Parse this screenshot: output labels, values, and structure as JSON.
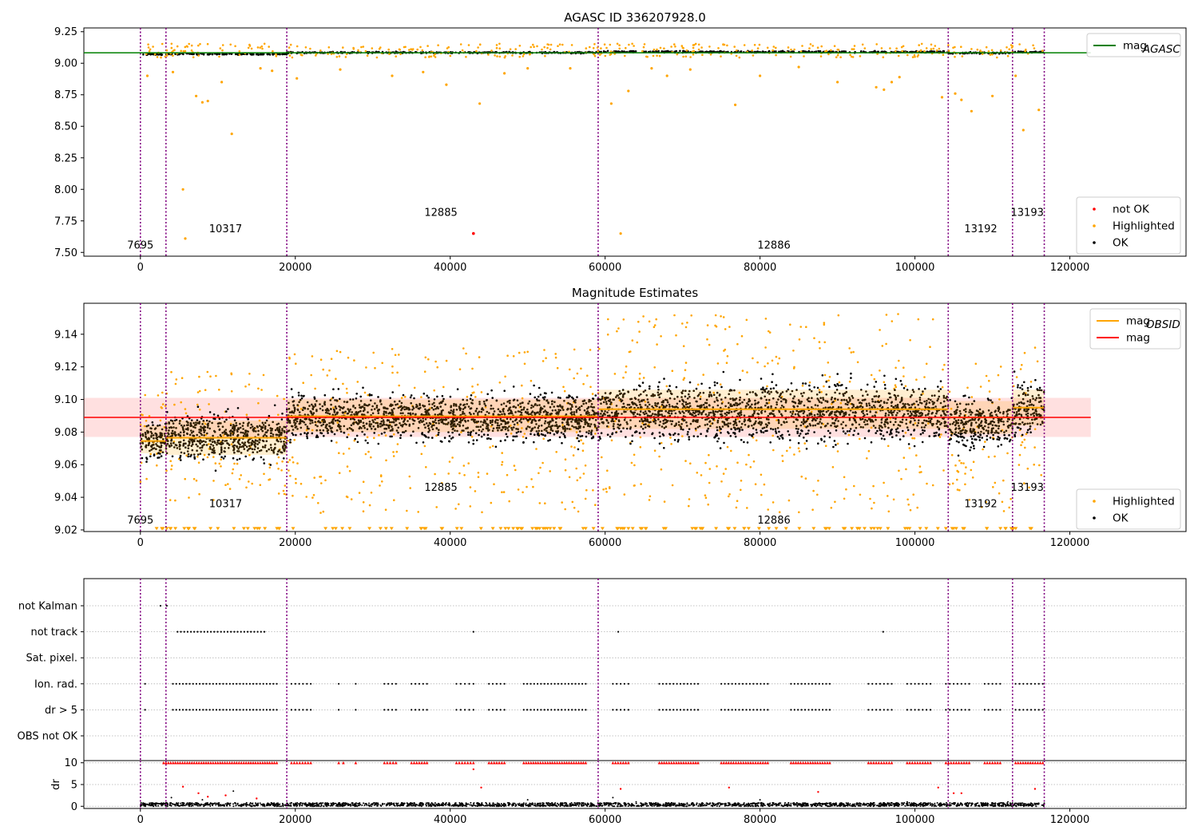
{
  "chart_data": [
    {
      "type": "scatter",
      "title": "AGASC ID 336207928.0",
      "xlim": [
        -7300,
        135000
      ],
      "ylim": [
        7.47,
        9.28
      ],
      "xticks": [
        0,
        20000,
        40000,
        60000,
        80000,
        100000,
        120000
      ],
      "yticks": [
        7.5,
        7.75,
        8.0,
        8.25,
        8.5,
        8.75,
        9.0,
        9.25
      ],
      "xtick_labels": [
        "0",
        "20000",
        "40000",
        "60000",
        "80000",
        "100000",
        "120000"
      ],
      "ytick_labels": [
        "7.50",
        "7.75",
        "8.00",
        "8.25",
        "8.50",
        "8.75",
        "9.00",
        "9.25"
      ],
      "lines": [
        {
          "name": "mag",
          "subscript": "AGASC",
          "y": 9.083,
          "x": [
            -7300,
            122700
          ],
          "color": "#008000"
        }
      ],
      "legends": [
        {
          "loc": "upper right",
          "items": [
            {
              "label": "mag",
              "sub": "AGASC",
              "kind": "line",
              "color": "#008000"
            }
          ]
        },
        {
          "loc": "lower right",
          "items": [
            {
              "label": "not OK",
              "kind": "dot",
              "color": "#ff0000"
            },
            {
              "label": "Highlighted",
              "kind": "dot",
              "color": "#ffa500"
            },
            {
              "label": "OK",
              "kind": "dot",
              "color": "#000000"
            }
          ]
        }
      ],
      "obs_labels": [
        {
          "text": "7695",
          "x": 0,
          "y": 7.53
        },
        {
          "text": "10317",
          "x": 11000,
          "y": 7.66
        },
        {
          "text": "12885",
          "x": 38800,
          "y": 7.79
        },
        {
          "text": "12886",
          "x": 81800,
          "y": 7.53
        },
        {
          "text": "13192",
          "x": 108500,
          "y": 7.66
        },
        {
          "text": "13193",
          "x": 114500,
          "y": 7.79
        }
      ],
      "series": [
        {
          "name": "OK",
          "color": "#000000",
          "segments": [
            {
              "x": [
                0,
                3300
              ],
              "center": 9.07,
              "spread": 0.018
            },
            {
              "x": [
                3300,
                18900
              ],
              "center": 9.073,
              "spread": 0.02
            },
            {
              "x": [
                18900,
                59100
              ],
              "center": 9.085,
              "spread": 0.02
            },
            {
              "x": [
                59100,
                104300
              ],
              "center": 9.09,
              "spread": 0.022
            },
            {
              "x": [
                104300,
                112600
              ],
              "center": 9.082,
              "spread": 0.02
            },
            {
              "x": [
                112600,
                116700
              ],
              "center": 9.09,
              "spread": 0.02
            }
          ]
        },
        {
          "name": "Highlighted",
          "color": "#ffa500",
          "points": [
            [
              900,
              8.9
            ],
            [
              5500,
              8.0
            ],
            [
              5800,
              7.61
            ],
            [
              7200,
              8.74
            ],
            [
              8000,
              8.69
            ],
            [
              8700,
              8.7
            ],
            [
              11800,
              8.44
            ],
            [
              10500,
              8.85
            ],
            [
              4200,
              8.93
            ],
            [
              15500,
              8.96
            ],
            [
              17000,
              8.94
            ],
            [
              20200,
              8.88
            ],
            [
              25800,
              8.95
            ],
            [
              32500,
              8.9
            ],
            [
              36500,
              8.93
            ],
            [
              39500,
              8.83
            ],
            [
              43800,
              8.68
            ],
            [
              47000,
              8.92
            ],
            [
              50000,
              8.96
            ],
            [
              55500,
              8.96
            ],
            [
              60800,
              8.68
            ],
            [
              62000,
              7.65
            ],
            [
              63000,
              8.78
            ],
            [
              66000,
              8.96
            ],
            [
              68000,
              8.9
            ],
            [
              71000,
              8.95
            ],
            [
              76800,
              8.67
            ],
            [
              80000,
              8.9
            ],
            [
              85000,
              8.97
            ],
            [
              90000,
              8.85
            ],
            [
              95000,
              8.81
            ],
            [
              96000,
              8.79
            ],
            [
              97000,
              8.85
            ],
            [
              98000,
              8.89
            ],
            [
              103500,
              8.73
            ],
            [
              105200,
              8.76
            ],
            [
              106000,
              8.71
            ],
            [
              107300,
              8.62
            ],
            [
              110000,
              8.74
            ],
            [
              113000,
              8.9
            ],
            [
              114000,
              8.47
            ],
            [
              116000,
              8.63
            ]
          ]
        },
        {
          "name": "not OK",
          "color": "#ff0000",
          "points": [
            [
              43000,
              7.65
            ]
          ]
        }
      ],
      "vlines": [
        0,
        3300,
        18900,
        59100,
        104300,
        112600,
        116700
      ]
    },
    {
      "type": "scatter",
      "title": "Magnitude Estimates",
      "xlim": [
        -7300,
        135000
      ],
      "ylim": [
        9.019,
        9.159
      ],
      "xticks": [
        0,
        20000,
        40000,
        60000,
        80000,
        100000,
        120000
      ],
      "yticks": [
        9.02,
        9.04,
        9.06,
        9.08,
        9.1,
        9.12,
        9.14
      ],
      "xtick_labels": [
        "0",
        "20000",
        "40000",
        "60000",
        "80000",
        "100000",
        "120000"
      ],
      "ytick_labels": [
        "9.02",
        "9.04",
        "9.06",
        "9.08",
        "9.10",
        "9.12",
        "9.14"
      ],
      "mag_line": {
        "name": "mag",
        "y": 9.089,
        "band": [
          9.077,
          9.101
        ],
        "x": [
          -7300,
          122700
        ],
        "color": "#ff0000"
      },
      "obsid_segments": [
        {
          "x": [
            0,
            3300
          ],
          "y": 9.0745,
          "band": [
            9.067,
            9.084
          ]
        },
        {
          "x": [
            3300,
            18900
          ],
          "y": 9.0765,
          "band": [
            9.066,
            9.087
          ]
        },
        {
          "x": [
            18900,
            59100
          ],
          "y": 9.0897,
          "band": [
            9.08,
            9.1
          ]
        },
        {
          "x": [
            59100,
            104300
          ],
          "y": 9.094,
          "band": [
            9.082,
            9.106
          ]
        },
        {
          "x": [
            104300,
            112600
          ],
          "y": 9.089,
          "band": [
            9.079,
            9.099
          ]
        },
        {
          "x": [
            112600,
            116700
          ],
          "y": 9.095,
          "band": [
            9.084,
            9.106
          ]
        }
      ],
      "legends": [
        {
          "loc": "upper right",
          "items": [
            {
              "label": "mag",
              "sub": "OBSID",
              "kind": "line",
              "color": "#ffa500"
            },
            {
              "label": "mag",
              "sub": "",
              "kind": "line",
              "color": "#ff0000"
            }
          ]
        },
        {
          "loc": "lower right",
          "items": [
            {
              "label": "Highlighted",
              "kind": "dot",
              "color": "#ffa500"
            },
            {
              "label": "OK",
              "kind": "dot",
              "color": "#000000"
            }
          ]
        }
      ],
      "obs_labels": [
        {
          "text": "7695",
          "x": 0,
          "y": 9.024
        },
        {
          "text": "10317",
          "x": 11000,
          "y": 9.034
        },
        {
          "text": "12885",
          "x": 38800,
          "y": 9.044
        },
        {
          "text": "12886",
          "x": 81800,
          "y": 9.024
        },
        {
          "text": "13192",
          "x": 108500,
          "y": 9.034
        },
        {
          "text": "13193",
          "x": 114500,
          "y": 9.044
        }
      ],
      "series": [
        {
          "name": "OK",
          "color": "#000000",
          "segments": [
            {
              "x": [
                0,
                3300
              ],
              "lo": 9.052,
              "hi": 9.097
            },
            {
              "x": [
                3300,
                18900
              ],
              "lo": 9.052,
              "hi": 9.102
            },
            {
              "x": [
                18900,
                59100
              ],
              "lo": 9.064,
              "hi": 9.115
            },
            {
              "x": [
                59100,
                104300
              ],
              "lo": 9.06,
              "hi": 9.124
            },
            {
              "x": [
                104300,
                112600
              ],
              "lo": 9.058,
              "hi": 9.112
            },
            {
              "x": [
                112600,
                116700
              ],
              "lo": 9.066,
              "hi": 9.124
            }
          ]
        },
        {
          "name": "Highlighted",
          "color": "#ffa500",
          "segments": [
            {
              "x": [
                0,
                3300
              ],
              "lo": 9.045,
              "hi": 9.108
            },
            {
              "x": [
                3300,
                18900
              ],
              "lo": 9.038,
              "hi": 9.117
            },
            {
              "x": [
                18900,
                59100
              ],
              "lo": 9.03,
              "hi": 9.132
            },
            {
              "x": [
                59100,
                104300
              ],
              "lo": 9.03,
              "hi": 9.153
            },
            {
              "x": [
                104300,
                112600
              ],
              "lo": 9.03,
              "hi": 9.124
            },
            {
              "x": [
                112600,
                116700
              ],
              "lo": 9.045,
              "hi": 9.145
            }
          ]
        }
      ],
      "vlines": [
        0,
        3300,
        18900,
        59100,
        104300,
        112600,
        116700
      ]
    },
    {
      "type": "scatter",
      "title": "",
      "categories": [
        "not Kalman",
        "not track",
        "Sat. pixel.",
        "Ion. rad.",
        "dr > 5",
        "OBS not OK"
      ],
      "flag_points": {
        "not Kalman": [
          [
            2600,
            3400
          ]
        ],
        "not track": [
          [
            4800,
            16000
          ],
          [
            43000,
            43000
          ],
          [
            61700,
            61700
          ],
          [
            95900,
            95900
          ]
        ],
        "Sat. pixel.": [],
        "Ion. rad.": [
          [
            600,
            600
          ],
          [
            4200,
            17600
          ],
          [
            19500,
            22000
          ],
          [
            25600,
            26200
          ],
          [
            27800,
            28200
          ],
          [
            31500,
            33000
          ],
          [
            35000,
            37000
          ],
          [
            40800,
            43000
          ],
          [
            45000,
            47000
          ],
          [
            49500,
            57500
          ],
          [
            61000,
            63000
          ],
          [
            67000,
            72000
          ],
          [
            75000,
            81000
          ],
          [
            84000,
            89000
          ],
          [
            94000,
            97000
          ],
          [
            99000,
            102000
          ],
          [
            104000,
            107000
          ],
          [
            109000,
            111000
          ],
          [
            113000,
            116500
          ]
        ],
        "dr > 5": [
          [
            600,
            600
          ],
          [
            4200,
            17600
          ],
          [
            19500,
            22000
          ],
          [
            25600,
            26200
          ],
          [
            27800,
            28200
          ],
          [
            31500,
            33000
          ],
          [
            35000,
            37000
          ],
          [
            40800,
            43000
          ],
          [
            45000,
            47000
          ],
          [
            49500,
            57500
          ],
          [
            61000,
            63000
          ],
          [
            67000,
            72000
          ],
          [
            75000,
            81000
          ],
          [
            84000,
            89000
          ],
          [
            94000,
            97000
          ],
          [
            99000,
            102000
          ],
          [
            104000,
            107000
          ],
          [
            109000,
            111000
          ],
          [
            113000,
            116500
          ]
        ],
        "OBS not OK": []
      },
      "xlim": [
        -7300,
        135000
      ],
      "vlines": [
        0,
        3300,
        18900,
        59100,
        104300,
        112600,
        116700
      ]
    },
    {
      "type": "scatter",
      "ylabel": "dr",
      "ylim": [
        -0.5,
        10.5
      ],
      "yticks": [
        0,
        5,
        10
      ],
      "ytick_labels": [
        "0",
        "5",
        "10"
      ],
      "xticks": [
        0,
        20000,
        40000,
        60000,
        80000,
        100000,
        120000
      ],
      "xtick_labels": [
        "0",
        "20000",
        "40000",
        "60000",
        "80000",
        "100000",
        "120000"
      ],
      "xlim": [
        -7300,
        135000
      ],
      "series": [
        {
          "name": "OK",
          "color": "#000000",
          "range": [
            0,
            116700
          ],
          "lo": 0,
          "hi": 0.8
        },
        {
          "name": "not OK",
          "color": "#ff0000",
          "y": 10,
          "x_ranges": [
            [
              3000,
              17600
            ],
            [
              19500,
              22000
            ],
            [
              25600,
              26200
            ],
            [
              27800,
              28200
            ],
            [
              31500,
              33000
            ],
            [
              35000,
              37000
            ],
            [
              40800,
              43000
            ],
            [
              45000,
              47000
            ],
            [
              49500,
              57500
            ],
            [
              61000,
              63000
            ],
            [
              67000,
              72000
            ],
            [
              75000,
              81000
            ],
            [
              84000,
              89000
            ],
            [
              94000,
              97000
            ],
            [
              99000,
              102000
            ],
            [
              104000,
              107000
            ],
            [
              109000,
              111000
            ],
            [
              113000,
              116500
            ]
          ]
        },
        {
          "name": "not OK scattered",
          "color": "#ff0000",
          "points": [
            [
              5500,
              4.5
            ],
            [
              7500,
              3.0
            ],
            [
              8700,
              2.2
            ],
            [
              11000,
              2.5
            ],
            [
              15000,
              1.8
            ],
            [
              43000,
              8.5
            ],
            [
              44000,
              4.3
            ],
            [
              62000,
              4.0
            ],
            [
              76000,
              4.3
            ],
            [
              87500,
              3.3
            ],
            [
              103000,
              4.3
            ],
            [
              105000,
              3.0
            ],
            [
              106000,
              3.0
            ],
            [
              115500,
              4.0
            ]
          ]
        },
        {
          "name": "OK scattered",
          "color": "#000000",
          "points": [
            [
              4000,
              2.0
            ],
            [
              8000,
              1.5
            ],
            [
              12000,
              3.5
            ],
            [
              50000,
              1.5
            ],
            [
              61000,
              2.0
            ],
            [
              64000,
              1.0
            ],
            [
              80000,
              1.5
            ],
            [
              99000,
              1.0
            ],
            [
              112000,
              1.0
            ]
          ]
        }
      ],
      "vlines": [
        0,
        3300,
        18900,
        59100,
        104300,
        112600,
        116700
      ]
    }
  ]
}
